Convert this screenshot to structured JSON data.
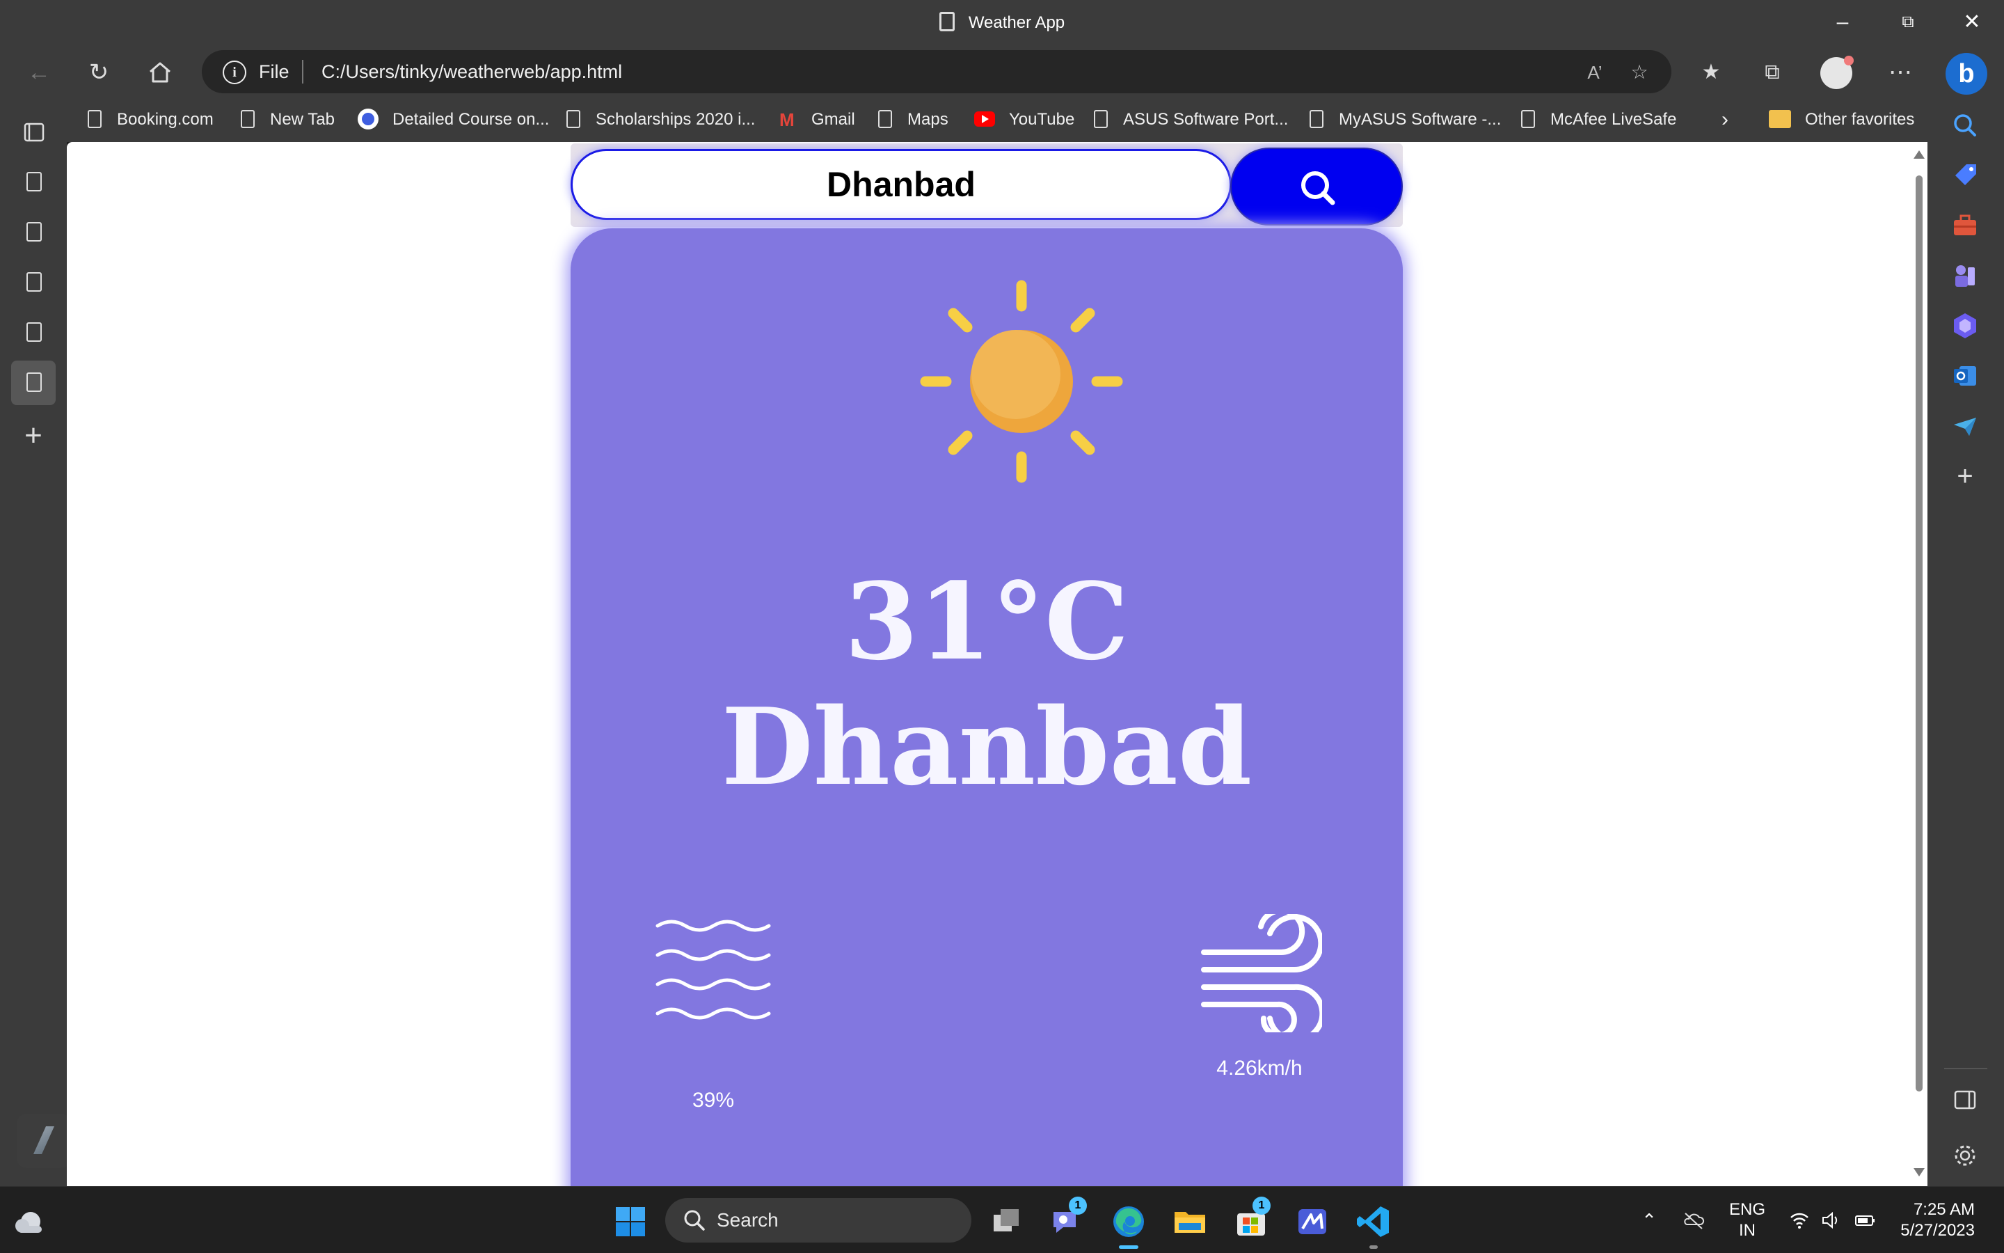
{
  "window": {
    "title": "Weather App"
  },
  "address_bar": {
    "scheme_label": "File",
    "url": "C:/Users/tinky/weatherweb/app.html"
  },
  "favorites": [
    {
      "label": "Booking.com",
      "icon": "page-icon"
    },
    {
      "label": "New Tab",
      "icon": "page-icon"
    },
    {
      "label": "Detailed Course on...",
      "icon": "course-icon"
    },
    {
      "label": "Scholarships 2020 i...",
      "icon": "page-icon"
    },
    {
      "label": "Gmail",
      "icon": "gmail-icon"
    },
    {
      "label": "Maps",
      "icon": "page-icon"
    },
    {
      "label": "YouTube",
      "icon": "youtube-icon"
    },
    {
      "label": "ASUS Software Port...",
      "icon": "page-icon"
    },
    {
      "label": "MyASUS Software -...",
      "icon": "page-icon"
    },
    {
      "label": "McAfee LiveSafe",
      "icon": "page-icon"
    }
  ],
  "other_favorites": "Other favorites",
  "weather": {
    "search_value": "Dhanbad",
    "temperature": "31°C",
    "city": "Dhanbad",
    "humidity": "39%",
    "wind_speed": "4.26km/h",
    "condition_icon": "sun-icon",
    "card_color": "#8277e0",
    "button_color": "#0000f0"
  },
  "taskbar": {
    "search_placeholder": "Search",
    "teams_badge": "1",
    "store_badge": "1",
    "language": "ENG",
    "region": "IN",
    "time": "7:25 AM",
    "date": "5/27/2023"
  }
}
